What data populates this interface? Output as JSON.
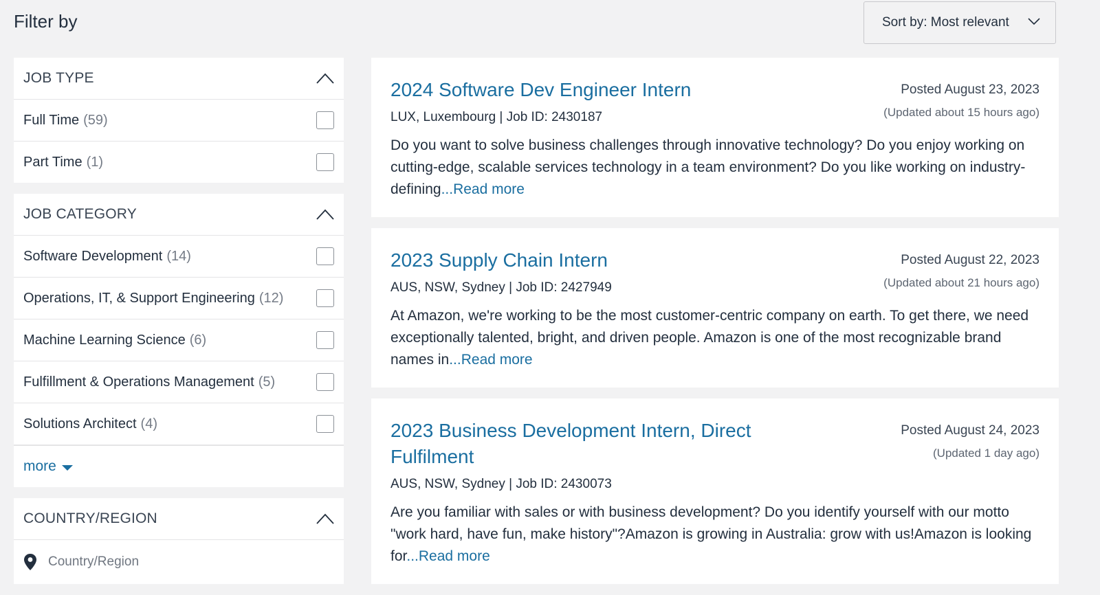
{
  "filter": {
    "title": "Filter by"
  },
  "sort": {
    "label": "Sort by: Most relevant"
  },
  "job_type": {
    "title": "JOB TYPE",
    "options": [
      {
        "label": "Full Time",
        "count": "(59)"
      },
      {
        "label": "Part Time",
        "count": "(1)"
      }
    ]
  },
  "job_category": {
    "title": "JOB CATEGORY",
    "options": [
      {
        "label": "Software Development",
        "count": "(14)"
      },
      {
        "label": "Operations, IT, & Support Engineering",
        "count": "(12)"
      },
      {
        "label": "Machine Learning Science",
        "count": "(6)"
      },
      {
        "label": "Fulfillment & Operations Management",
        "count": "(5)"
      },
      {
        "label": "Solutions Architect",
        "count": "(4)"
      }
    ],
    "more_label": "more"
  },
  "country_region": {
    "title": "COUNTRY/REGION",
    "placeholder": "Country/Region"
  },
  "jobs": [
    {
      "title": "2024 Software Dev Engineer Intern",
      "meta": "LUX, Luxembourg | Job ID: 2430187",
      "posted": "Posted August 23, 2023",
      "updated": "(Updated about 15 hours ago)",
      "desc": "Do you want to solve business challenges through innovative technology? Do you enjoy working on cutting-edge, scalable services technology in a team environment? Do you like working on industry-defining",
      "read_more": "...Read more"
    },
    {
      "title": "2023 Supply Chain Intern",
      "meta": "AUS, NSW, Sydney | Job ID: 2427949",
      "posted": "Posted August 22, 2023",
      "updated": "(Updated about 21 hours ago)",
      "desc": "At Amazon, we're working to be the most customer-centric company on earth. To get there, we need exceptionally talented, bright, and driven people. Amazon is one of the most recognizable brand names in",
      "read_more": "...Read more"
    },
    {
      "title": "2023 Business Development Intern, Direct Fulfilment",
      "meta": "AUS, NSW, Sydney | Job ID: 2430073",
      "posted": "Posted August 24, 2023",
      "updated": "(Updated 1 day ago)",
      "desc": "Are you familiar with sales or with business development? Do you identify yourself with our motto \"work hard, have fun, make history\"?Amazon is growing in Australia: grow with us!Amazon is looking for",
      "read_more": "...Read more"
    }
  ]
}
